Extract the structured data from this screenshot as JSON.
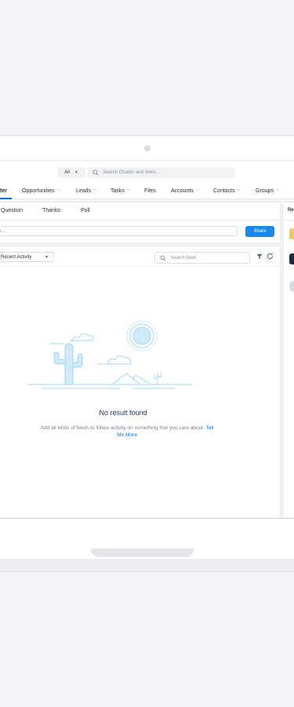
{
  "topbar": {
    "scope_label": "All",
    "search_placeholder": "Search Chatter and more..."
  },
  "nav": {
    "items": [
      {
        "label": "ter",
        "active": true
      },
      {
        "label": "Opportunities"
      },
      {
        "label": "Leads"
      },
      {
        "label": "Tasks"
      },
      {
        "label": "Files"
      },
      {
        "label": "Accounts"
      },
      {
        "label": "Contacts"
      },
      {
        "label": "Groups"
      }
    ]
  },
  "publisher": {
    "tabs": [
      "Question",
      "Thanks",
      "Poll"
    ],
    "input_placeholder": "e...",
    "share_label": "Share"
  },
  "feed": {
    "sort_label": "Recent Activity",
    "search_placeholder": "Search feed...",
    "empty_title": "No result found",
    "empty_desc": "Add all kinds of feeds to follow activity on something that you care about.",
    "empty_link": "Tell Me More"
  },
  "sidebar": {
    "header": "Re"
  },
  "colors": {
    "accent": "#0070d2",
    "button": "#1589ee",
    "illustration": "#9fd6f3"
  }
}
